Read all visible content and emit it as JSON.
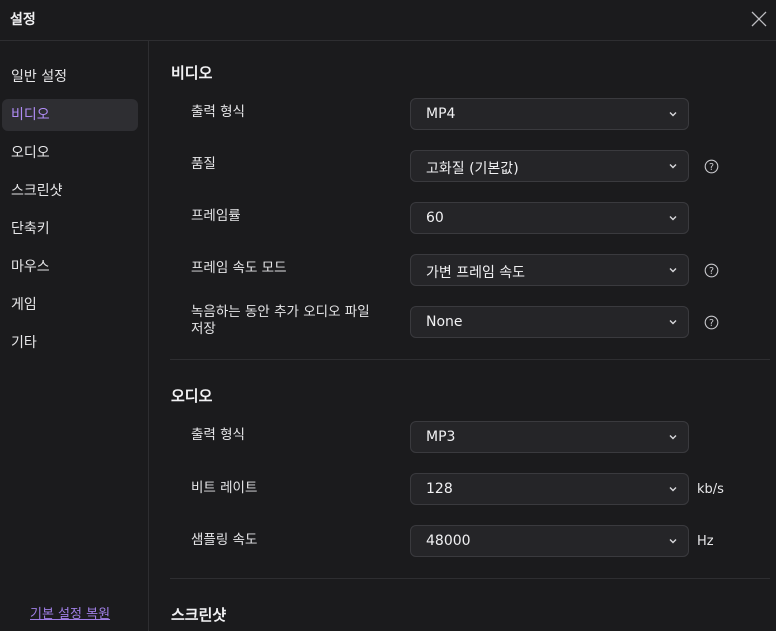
{
  "window": {
    "title": "설정"
  },
  "sidebar": {
    "items": [
      {
        "label": "일반 설정"
      },
      {
        "label": "비디오"
      },
      {
        "label": "오디오"
      },
      {
        "label": "스크린샷"
      },
      {
        "label": "단축키"
      },
      {
        "label": "마우스"
      },
      {
        "label": "게임"
      },
      {
        "label": "기타"
      }
    ],
    "active": "비디오",
    "reset_label": "기본 설정 복원"
  },
  "video": {
    "title": "비디오",
    "output_format": {
      "label": "출력 형식",
      "value": "MP4"
    },
    "quality": {
      "label": "품질",
      "value": "고화질 (기본값)"
    },
    "frame_rate": {
      "label": "프레임률",
      "value": "60"
    },
    "frame_rate_mode": {
      "label": "프레임 속도 모드",
      "value": "가변 프레임 속도"
    },
    "extra_audio": {
      "label_line1": "녹음하는 동안 추가 오디오 파일",
      "label_line2": "저장",
      "value": "None"
    }
  },
  "audio": {
    "title": "오디오",
    "output_format": {
      "label": "출력 형식",
      "value": "MP3"
    },
    "bitrate": {
      "label": "비트 레이트",
      "value": "128",
      "unit": "kb/s"
    },
    "sample_rate": {
      "label": "샘플링 속도",
      "value": "48000",
      "unit": "Hz"
    }
  },
  "screenshot": {
    "title": "스크린샷"
  },
  "colors": {
    "accent": "#b08cf5",
    "background": "#1b1b1d",
    "control": "#252528"
  }
}
